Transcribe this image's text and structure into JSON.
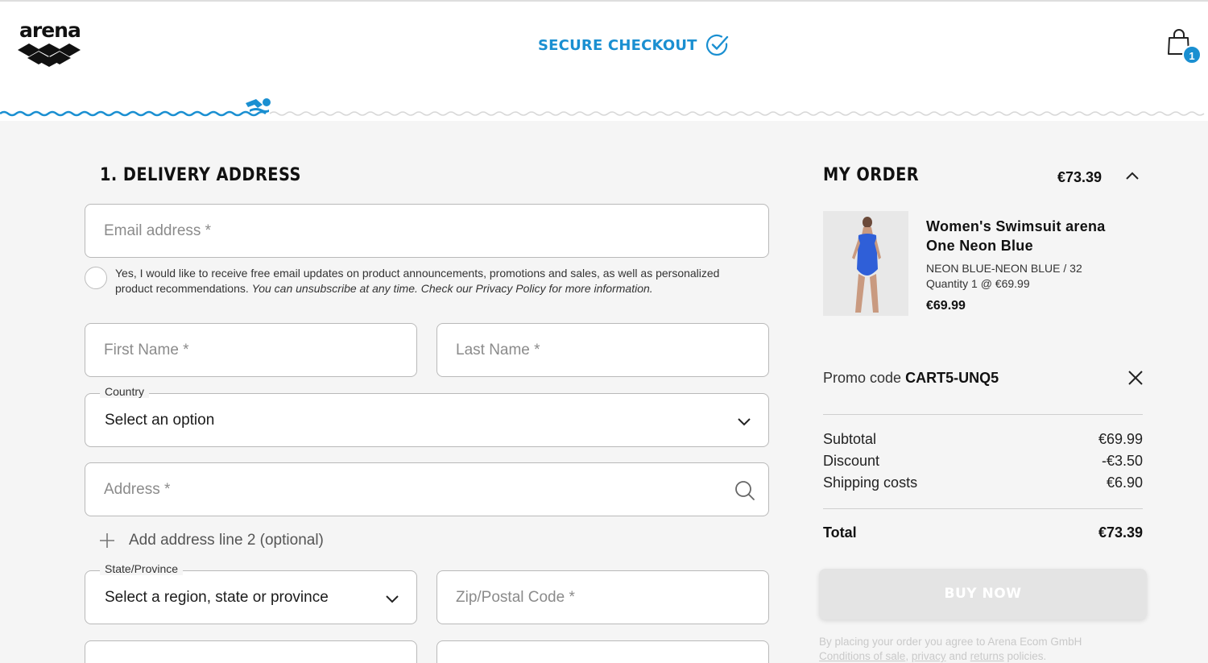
{
  "header": {
    "logo_text": "arena",
    "secure_checkout_label": "SECURE CHECKOUT",
    "cart_count": "1",
    "accent_color": "#1a8fd1"
  },
  "delivery": {
    "title": "1. DELIVERY ADDRESS",
    "email_placeholder": "Email address *",
    "consent_text": "Yes, I would like to receive free email updates on product announcements, promotions and sales, as well as personalized product recommendations.",
    "consent_italic": "You can unsubscribe at any time. Check our Privacy Policy for more information.",
    "first_name_placeholder": "First Name  *",
    "last_name_placeholder": "Last Name  *",
    "country_label": "Country",
    "country_value": "Select an option",
    "address_placeholder": "Address  *",
    "add_line2_label": "Add address line 2 (optional)",
    "state_label": "State/Province",
    "state_value": "Select a region, state or province",
    "zip_placeholder": "Zip/Postal Code  *"
  },
  "order": {
    "title": "MY ORDER",
    "total_top": "€73.39",
    "product": {
      "name": "Women's Swimsuit arena One Neon Blue",
      "variant": "NEON BLUE-NEON BLUE  /  32",
      "quantity": "Quantity 1 @ €69.99",
      "price": "€69.99"
    },
    "promo_label": "Promo code",
    "promo_code": "CART5-UNQ5",
    "summary": [
      {
        "label": "Subtotal",
        "value": "€69.99"
      },
      {
        "label": "Discount",
        "value": "-€3.50"
      },
      {
        "label": "Shipping costs",
        "value": "€6.90"
      }
    ],
    "total_label": "Total",
    "total_value": "€73.39",
    "buy_label": "BUY NOW",
    "legal_line1": "By placing your order you agree to Arena Ecom GmbH",
    "legal_link1": "Conditions of sale",
    "legal_link2": "privacy",
    "legal_and": "and",
    "legal_link3": "returns",
    "legal_end": "policies."
  }
}
